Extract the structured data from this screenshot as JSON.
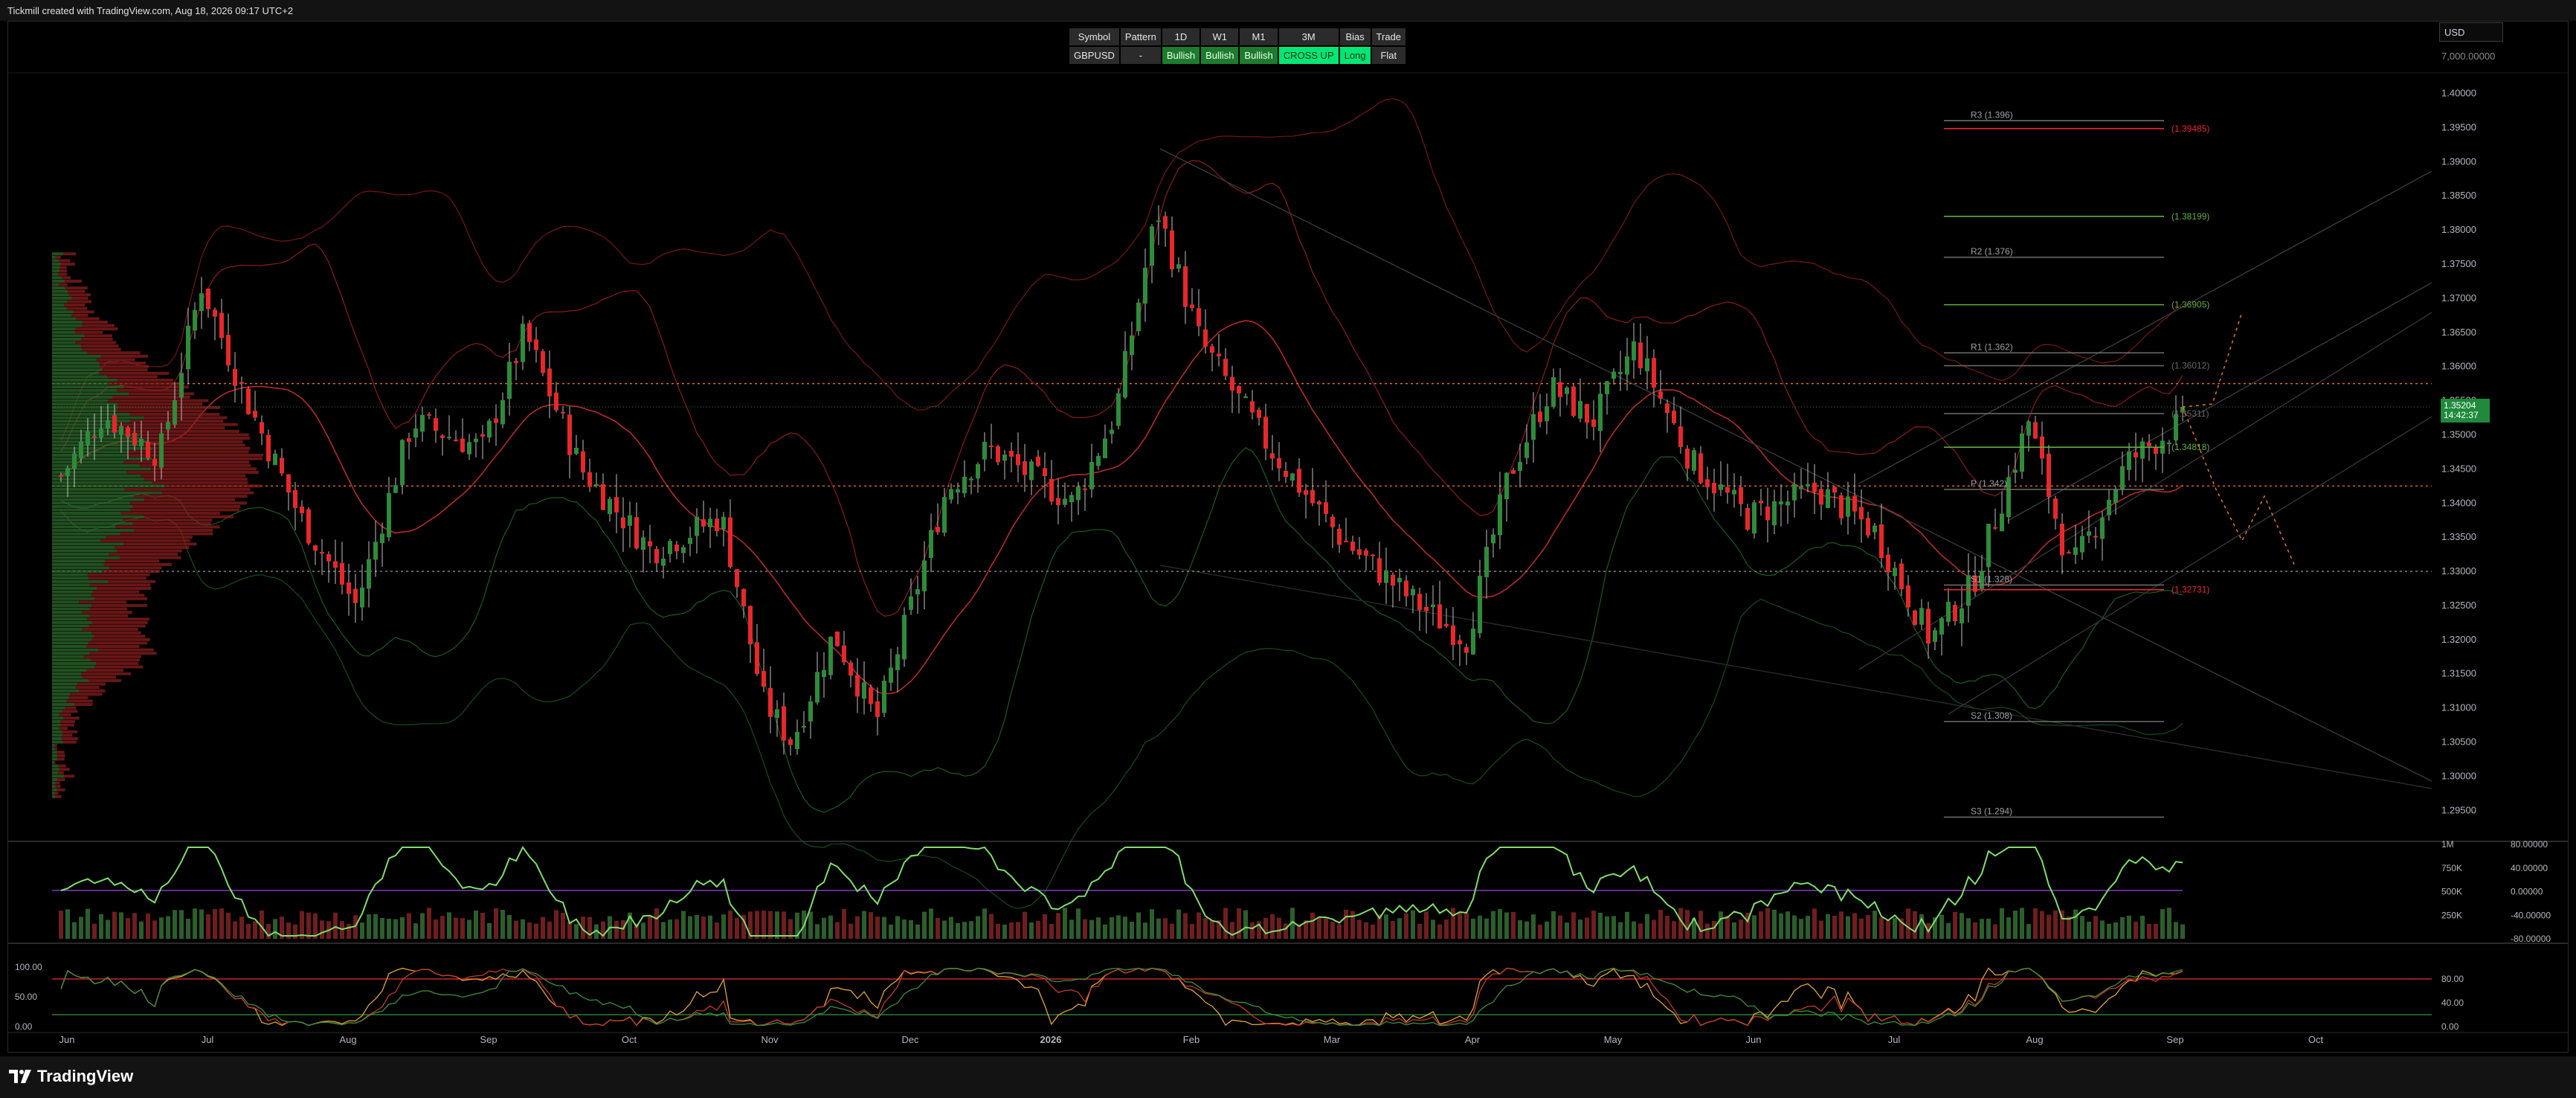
{
  "header": {
    "caption": "Tickmill created with TradingView.com, Aug 18, 2026 09:17 UTC+2"
  },
  "footer": {
    "brand": "TradingView"
  },
  "currency_select": {
    "value": "USD"
  },
  "signal_table": {
    "headers": [
      "Symbol",
      "Pattern",
      "1D",
      "W1",
      "M1",
      "3M",
      "Bias",
      "Trade"
    ],
    "row": [
      "GBPUSD",
      "-",
      "Bullish",
      "Bullish",
      "Bullish",
      "CROSS UP",
      "Long",
      "Flat"
    ]
  },
  "last_price": {
    "value": "1.35204",
    "countdown": "14:42:37"
  },
  "colors": {
    "up": "#2e8b3a",
    "down": "#e8272b",
    "bg": "#000000",
    "accent_green": "#00e676"
  },
  "chart_data": [
    {
      "type": "candlestick",
      "symbol": "GBPUSD",
      "x_tick_labels": [
        "Jun",
        "Jul",
        "Aug",
        "Sep",
        "Oct",
        "Nov",
        "Dec",
        "2026",
        "Feb",
        "Mar",
        "Apr",
        "May",
        "Jun",
        "Jul",
        "Aug",
        "Sep",
        "Oct"
      ],
      "y_tick_labels": [
        "1.29500",
        "1.30000",
        "1.30500",
        "1.31000",
        "1.31500",
        "1.32000",
        "1.32500",
        "1.33000",
        "1.33500",
        "1.34000",
        "1.34500",
        "1.35000",
        "1.35500",
        "1.36000",
        "1.36500",
        "1.37000",
        "1.37500",
        "1.38000",
        "1.38500",
        "1.39000",
        "1.39500",
        "1.40000"
      ],
      "extra_axis_label": "7,000.00000",
      "ylim": [
        1.291,
        1.403
      ],
      "price_path": [
        {
          "m": 0,
          "p": 1.344
        },
        {
          "m": 0.3,
          "p": 1.353
        },
        {
          "m": 0.7,
          "p": 1.347
        },
        {
          "m": 1.0,
          "p": 1.372
        },
        {
          "m": 1.3,
          "p": 1.356
        },
        {
          "m": 1.7,
          "p": 1.338
        },
        {
          "m": 2.1,
          "p": 1.325
        },
        {
          "m": 2.5,
          "p": 1.352
        },
        {
          "m": 3.0,
          "p": 1.348
        },
        {
          "m": 3.3,
          "p": 1.365
        },
        {
          "m": 3.7,
          "p": 1.345
        },
        {
          "m": 4.2,
          "p": 1.333
        },
        {
          "m": 4.7,
          "p": 1.338
        },
        {
          "m": 5.0,
          "p": 1.311
        },
        {
          "m": 5.2,
          "p": 1.305
        },
        {
          "m": 5.5,
          "p": 1.321
        },
        {
          "m": 5.8,
          "p": 1.308
        },
        {
          "m": 6.3,
          "p": 1.342
        },
        {
          "m": 6.6,
          "p": 1.348
        },
        {
          "m": 7.2,
          "p": 1.34
        },
        {
          "m": 7.5,
          "p": 1.353
        },
        {
          "m": 7.8,
          "p": 1.383
        },
        {
          "m": 8.1,
          "p": 1.364
        },
        {
          "m": 8.6,
          "p": 1.348
        },
        {
          "m": 9.1,
          "p": 1.335
        },
        {
          "m": 9.6,
          "p": 1.326
        },
        {
          "m": 10.0,
          "p": 1.32
        },
        {
          "m": 10.3,
          "p": 1.344
        },
        {
          "m": 10.6,
          "p": 1.357
        },
        {
          "m": 10.9,
          "p": 1.352
        },
        {
          "m": 11.2,
          "p": 1.363
        },
        {
          "m": 11.6,
          "p": 1.346
        },
        {
          "m": 12.0,
          "p": 1.338
        },
        {
          "m": 12.5,
          "p": 1.342
        },
        {
          "m": 12.9,
          "p": 1.336
        },
        {
          "m": 13.3,
          "p": 1.32
        },
        {
          "m": 13.6,
          "p": 1.328
        },
        {
          "m": 14.0,
          "p": 1.352
        },
        {
          "m": 14.3,
          "p": 1.33
        },
        {
          "m": 14.7,
          "p": 1.346
        },
        {
          "m": 15.1,
          "p": 1.352
        }
      ],
      "pivot_levels": [
        {
          "label": "R3 (1.396)",
          "value": 1.396
        },
        {
          "label": "R2 (1.376)",
          "value": 1.376
        },
        {
          "label": "R1 (1.362)",
          "value": 1.362
        },
        {
          "label": "P (1.342)",
          "value": 1.342
        },
        {
          "label": "S1 (1.328)",
          "value": 1.328
        },
        {
          "label": "S2 (1.308)",
          "value": 1.308
        },
        {
          "label": "S3 (1.294)",
          "value": 1.294
        }
      ],
      "target_levels": [
        {
          "label": "(1.39485)",
          "value": 1.39485,
          "color": "#e8272b"
        },
        {
          "label": "(1.38199)",
          "value": 1.38199,
          "color": "#5fae3b"
        },
        {
          "label": "(1.36905)",
          "value": 1.36905,
          "color": "#5fae3b"
        },
        {
          "label": "(1.36012)",
          "value": 1.36012,
          "color": "#666666"
        },
        {
          "label": "(1.35311)",
          "value": 1.35311,
          "color": "#666666"
        },
        {
          "label": "(1.34818)",
          "value": 1.34818,
          "color": "#5fae3b"
        },
        {
          "label": "(1.32731)",
          "value": 1.32731,
          "color": "#e8272b"
        }
      ],
      "horizontal_dotted": [
        1.3575,
        1.3425,
        1.33
      ]
    },
    {
      "type": "bar",
      "name": "volume + oscillator",
      "y_tick_labels_left": [
        "1M",
        "750K",
        "500K",
        "250K"
      ],
      "y_tick_labels_right": [
        "80.00000",
        "40.00000",
        "0.00000",
        "-40.00000",
        "-80.00000"
      ]
    },
    {
      "type": "line",
      "name": "stochastic",
      "y_tick_labels_left": [
        "100.00",
        "50.00",
        "0.00"
      ],
      "y_tick_labels_right": [
        "80.00",
        "40.00",
        "0.00"
      ],
      "levels": [
        80,
        20
      ]
    }
  ]
}
